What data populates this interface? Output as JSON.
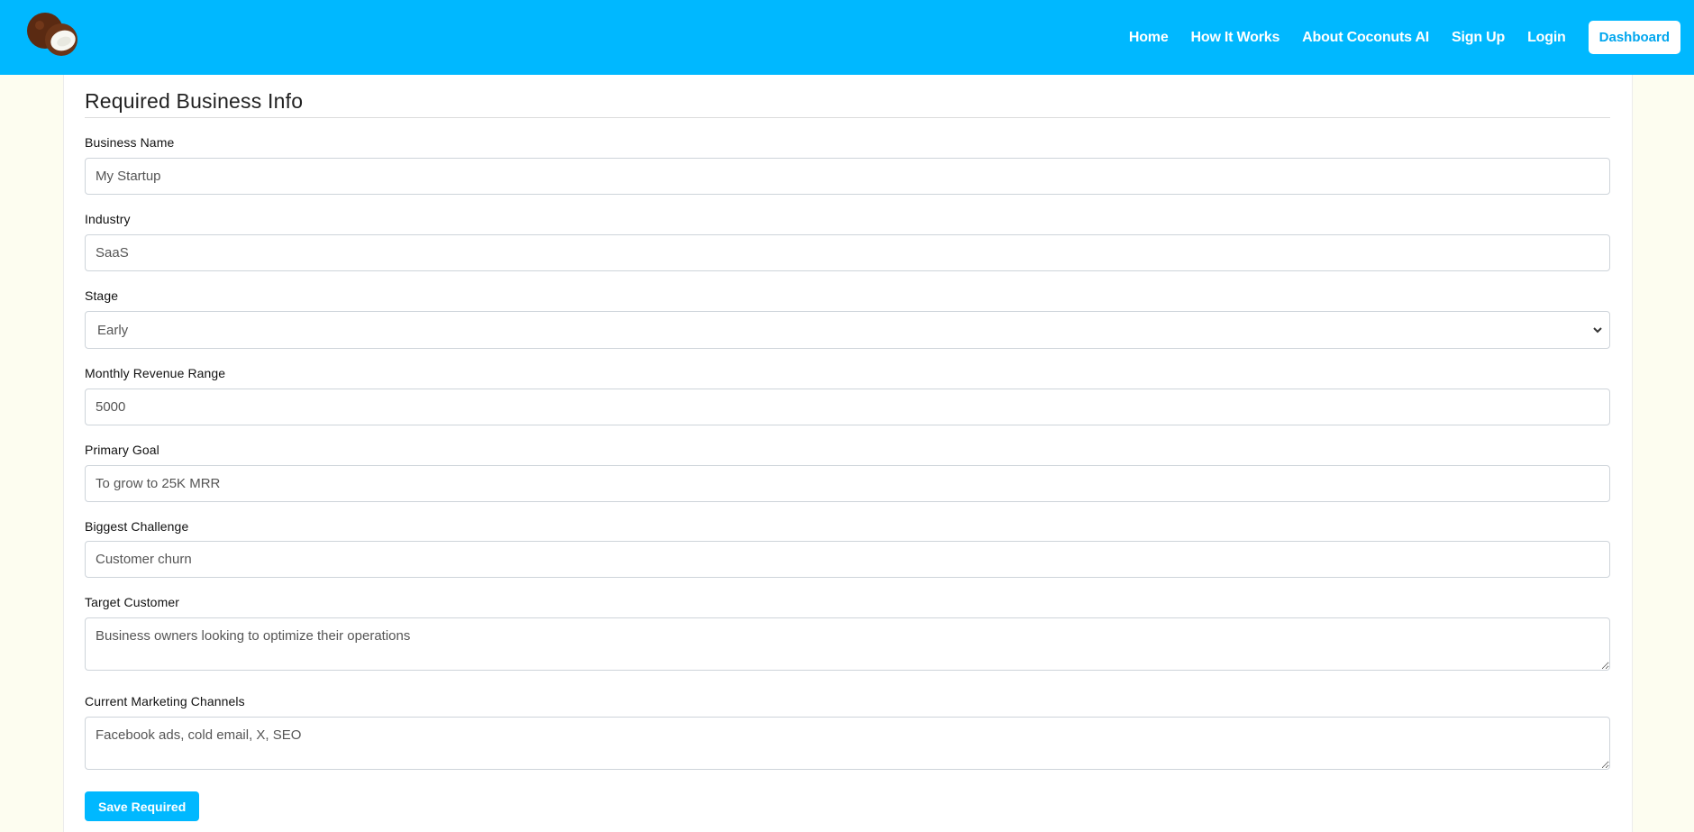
{
  "nav": {
    "logo_icon": "coconut-logo-icon",
    "links": [
      "Home",
      "How It Works",
      "About Coconuts AI",
      "Sign Up",
      "Login"
    ],
    "dashboard_label": "Dashboard"
  },
  "form": {
    "title": "Required Business Info",
    "business_name": {
      "label": "Business Name",
      "value": "My Startup"
    },
    "industry": {
      "label": "Industry",
      "value": "SaaS"
    },
    "stage": {
      "label": "Stage",
      "value": "Early"
    },
    "monthly_revenue": {
      "label": "Monthly Revenue Range",
      "value": "5000"
    },
    "primary_goal": {
      "label": "Primary Goal",
      "value": "To grow to 25K MRR"
    },
    "biggest_challenge": {
      "label": "Biggest Challenge",
      "value": "Customer churn"
    },
    "target_customer": {
      "label": "Target Customer",
      "value": "Business owners looking to optimize their operations"
    },
    "marketing_channels": {
      "label": "Current Marketing Channels",
      "value": "Facebook ads, cold email, X, SEO"
    },
    "save_label": "Save Required"
  },
  "colors": {
    "brand": "#00b8ff",
    "page_background": "#fdfdf0"
  }
}
